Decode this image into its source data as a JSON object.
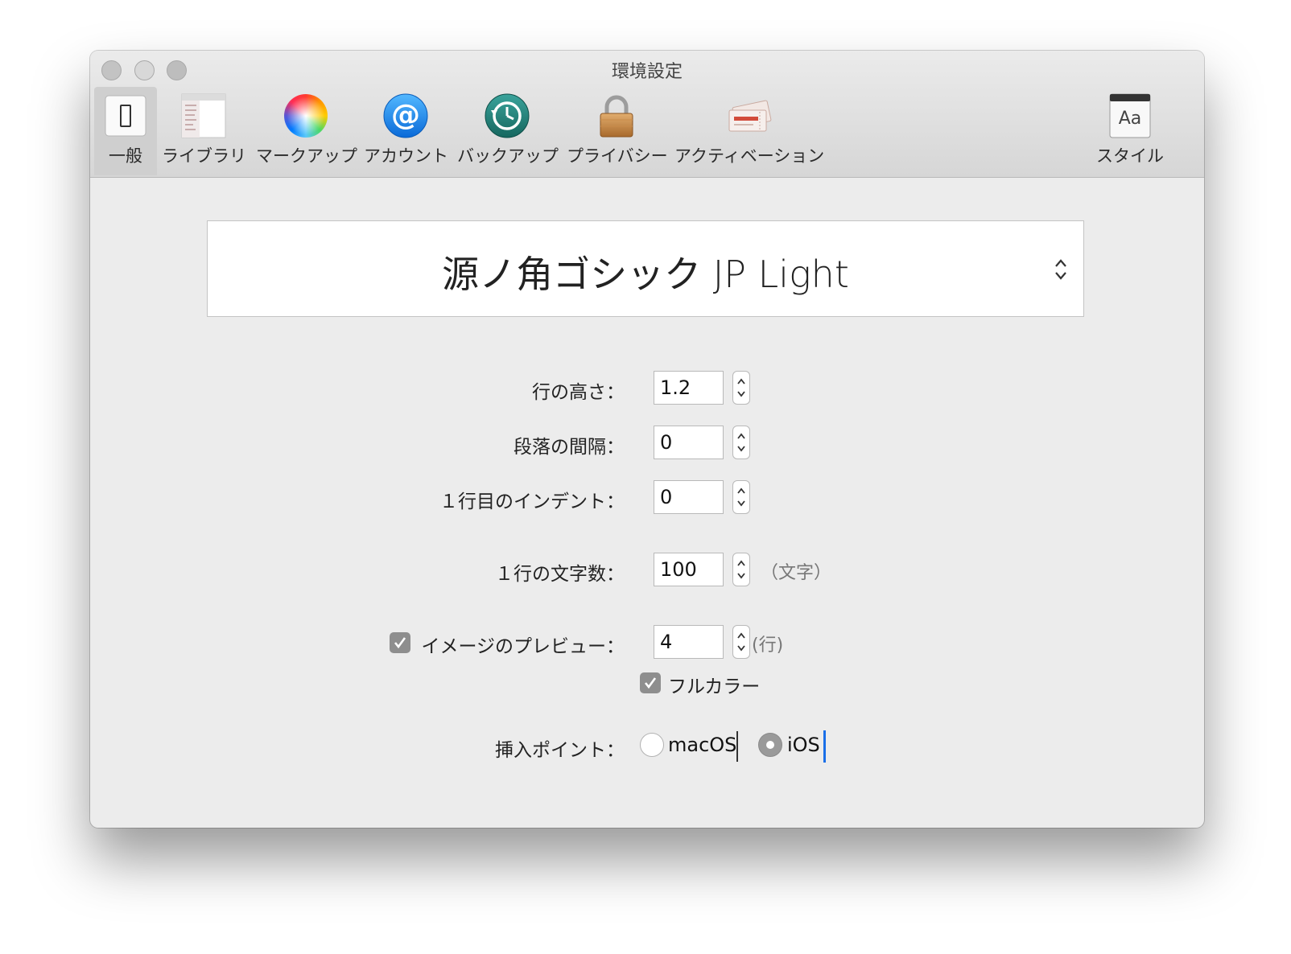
{
  "window": {
    "title": "環境設定"
  },
  "toolbar": {
    "items": [
      {
        "label": "一般",
        "icon": "general-switch-icon",
        "selected": true
      },
      {
        "label": "ライブラリ",
        "icon": "library-icon"
      },
      {
        "label": "マークアップ",
        "icon": "color-wheel-icon"
      },
      {
        "label": "アカウント",
        "icon": "at-sign-icon"
      },
      {
        "label": "バックアップ",
        "icon": "time-machine-icon"
      },
      {
        "label": "プライバシー",
        "icon": "lock-icon"
      },
      {
        "label": "アクティベーション",
        "icon": "ticket-icon"
      },
      {
        "label": "スタイル",
        "icon": "font-style-icon"
      }
    ]
  },
  "font_selector": {
    "value": "源ノ角ゴシック JP Light"
  },
  "settings": {
    "line_height": {
      "label": "行の高さ：",
      "value": "1.2"
    },
    "paragraph_spacing": {
      "label": "段落の間隔：",
      "value": "0"
    },
    "first_line_indent": {
      "label": "１行目のインデント：",
      "value": "0"
    },
    "chars_per_line": {
      "label": "１行の文字数：",
      "value": "100",
      "unit": "（文字）"
    },
    "image_preview": {
      "label": "イメージのプレビュー：",
      "checked": true,
      "value": "4",
      "unit": "(行)"
    },
    "full_color": {
      "label": "フルカラー",
      "checked": true
    },
    "insertion_point": {
      "label": "挿入ポイント：",
      "options": [
        {
          "label": "macOS",
          "selected": false
        },
        {
          "label": "iOS",
          "selected": true
        }
      ]
    }
  },
  "colors": {
    "accent": "#1a6fe8",
    "checkbox": "#8e8e8e"
  }
}
